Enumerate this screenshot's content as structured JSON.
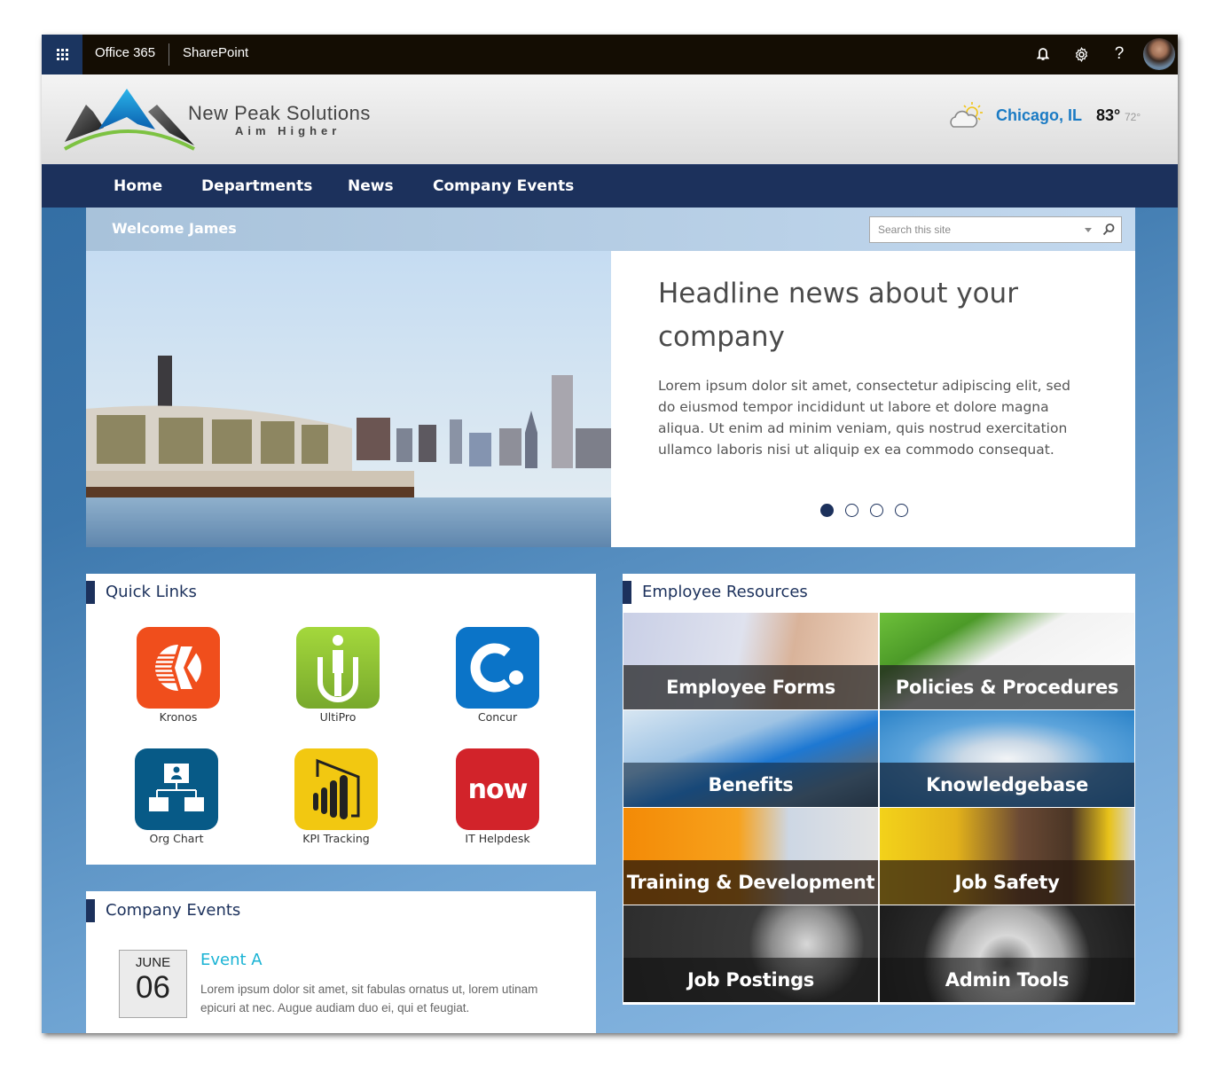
{
  "suitebar": {
    "brand": "Office 365",
    "app": "SharePoint",
    "icons": [
      "app-launcher-icon",
      "bell-icon",
      "gear-icon",
      "help-icon",
      "avatar"
    ]
  },
  "header": {
    "logo_name": "New Peak Solutions",
    "logo_tagline": "Aim Higher",
    "weather": {
      "icon": "partly-cloudy-icon",
      "city": "Chicago, IL",
      "high": "83°",
      "low": "72°"
    }
  },
  "nav": {
    "items": [
      {
        "label": "Home"
      },
      {
        "label": "Departments"
      },
      {
        "label": "News"
      },
      {
        "label": "Company Events"
      }
    ]
  },
  "welcome": {
    "text": "Welcome James",
    "search_placeholder": "Search this site",
    "search_value": ""
  },
  "hero": {
    "image": "chicago-skyline-lakefront",
    "title": "Headline news about your company",
    "body": "Lorem ipsum dolor sit amet, consectetur adipiscing elit, sed do eiusmod tempor incididunt ut labore et dolore magna aliqua. Ut enim ad minim veniam, quis nostrud exercitation ullamco laboris nisi ut aliquip ex ea commodo consequat.",
    "slides": 4,
    "active_slide": 1
  },
  "quick_links": {
    "title": "Quick Links",
    "items": [
      {
        "label": "Kronos",
        "icon": "kronos-icon",
        "color": "#f04e1c"
      },
      {
        "label": "UltiPro",
        "icon": "ultipro-icon",
        "color": "#8cc63f"
      },
      {
        "label": "Concur",
        "icon": "concur-icon",
        "color": "#0b74c8"
      },
      {
        "label": "Org Chart",
        "icon": "org-chart-icon",
        "color": "#075a87"
      },
      {
        "label": "KPI Tracking",
        "icon": "power-bi-icon",
        "color": "#f2c811"
      },
      {
        "label": "IT Helpdesk",
        "icon": "servicenow-icon",
        "color": "#d2232a",
        "logo_text": "now"
      }
    ]
  },
  "company_events": {
    "title": "Company Events",
    "events": [
      {
        "month": "JUNE",
        "day": "06",
        "title": "Event A",
        "description": "Lorem ipsum dolor sit amet, sit fabulas ornatus ut, lorem utinam epicuri at nec. Augue audiam duo ei, qui et feugiat."
      }
    ]
  },
  "employee_resources": {
    "title": "Employee Resources",
    "tiles": [
      {
        "label": "Employee Forms",
        "image": "hand-writing-with-pen"
      },
      {
        "label": "Policies & Procedures",
        "image": "green-pen-checklist"
      },
      {
        "label": "Benefits",
        "image": "stethoscope-clipboard"
      },
      {
        "label": "Knowledgebase",
        "image": "open-book"
      },
      {
        "label": "Training & Development",
        "image": "person-at-laptop"
      },
      {
        "label": "Job Safety",
        "image": "hard-hat-boots-gear"
      },
      {
        "label": "Job Postings",
        "image": "magnifying-glass-people"
      },
      {
        "label": "Admin Tools",
        "image": "metal-gears"
      }
    ]
  },
  "colors": {
    "suitebar_bg": "#140d03",
    "app_launcher_bg": "#1b3560",
    "nav_bg": "#1c315c",
    "weather_city": "#1b7bc4",
    "event_title": "#1ab3d4",
    "panel_title": "#1c315c"
  }
}
